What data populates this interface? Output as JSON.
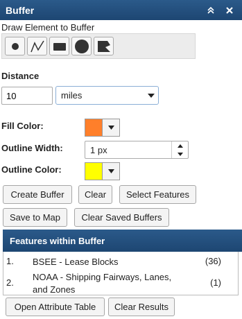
{
  "panel": {
    "title": "Buffer",
    "collapse_icon": "double-chevron-up-icon",
    "close_icon": "close-icon"
  },
  "draw": {
    "label": "Draw Element to Buffer",
    "tools": [
      {
        "name": "point-tool",
        "icon": "point-icon"
      },
      {
        "name": "polyline-tool",
        "icon": "polyline-icon"
      },
      {
        "name": "rectangle-tool",
        "icon": "rectangle-icon"
      },
      {
        "name": "circle-tool",
        "icon": "circle-icon"
      },
      {
        "name": "polygon-tool",
        "icon": "polygon-icon"
      }
    ]
  },
  "distance": {
    "label": "Distance",
    "value": "10",
    "units": "miles"
  },
  "fill": {
    "label": "Fill Color:",
    "color": "#ff7f2a"
  },
  "outline_width": {
    "label": "Outline Width:",
    "value": "1 px"
  },
  "outline_color": {
    "label": "Outline Color:",
    "color": "#ffff00"
  },
  "buttons": {
    "create_buffer": "Create Buffer",
    "clear": "Clear",
    "select_features": "Select Features",
    "save_to_map": "Save to Map",
    "clear_saved_buffers": "Clear Saved Buffers",
    "open_attribute_table": "Open Attribute Table",
    "clear_results": "Clear Results"
  },
  "features": {
    "header": "Features within Buffer",
    "items": [
      {
        "num": "1.",
        "name": "BSEE - Lease Blocks",
        "count": "(36)"
      },
      {
        "num": "2.",
        "name": "NOAA - Shipping Fairways, Lanes, and Zones",
        "count": "(1)"
      }
    ]
  },
  "colors": {
    "header_bg": "#234f7e",
    "fill_color": "#ff7f2a",
    "outline_color": "#ffff00"
  }
}
